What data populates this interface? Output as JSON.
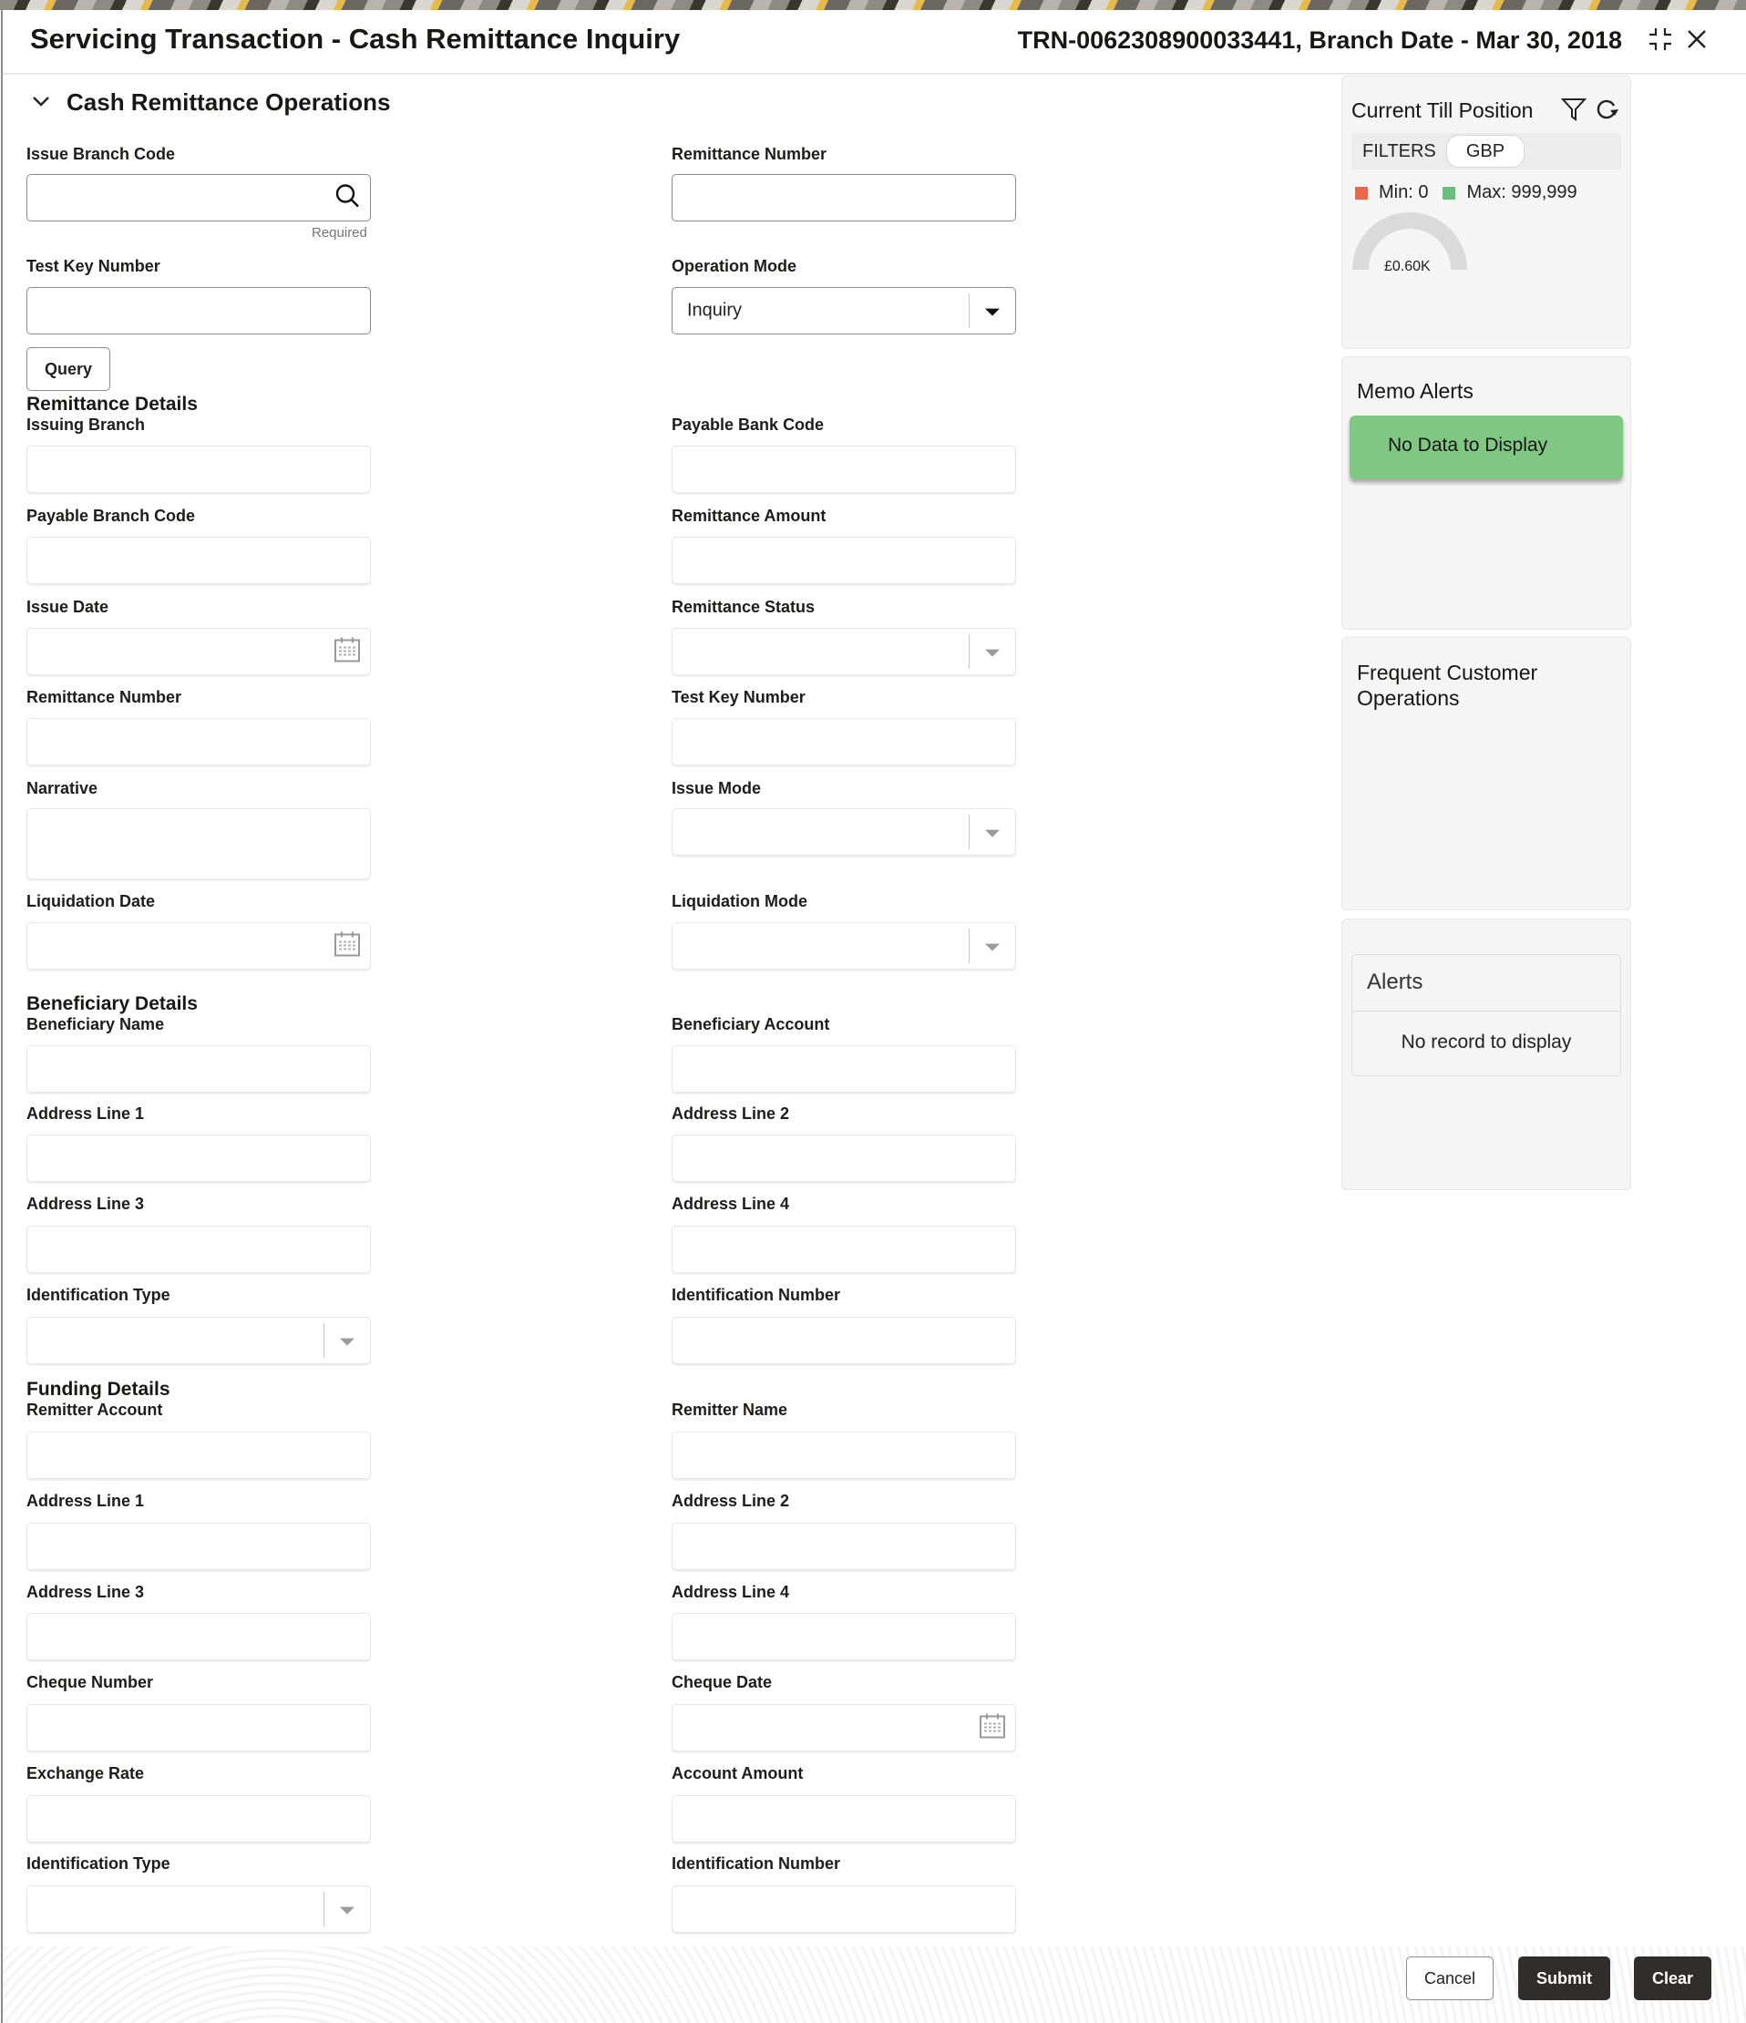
{
  "header": {
    "title": "Servicing Transaction - Cash Remittance Inquiry",
    "transaction_info": "TRN-0062308900033441, Branch Date - Mar 30, 2018",
    "minimize_icon": "minimize-icon",
    "close_icon": "close-icon"
  },
  "section": {
    "title": "Cash Remittance Operations",
    "toggle_icon": "chevron-down-icon"
  },
  "query": {
    "issue_branch_code": {
      "label": "Issue Branch Code",
      "value": "",
      "hint": "Required",
      "icon": "search-icon"
    },
    "remittance_number": {
      "label": "Remittance Number",
      "value": ""
    },
    "test_key_number": {
      "label": "Test Key Number",
      "value": ""
    },
    "operation_mode": {
      "label": "Operation Mode",
      "value": "Inquiry"
    },
    "query_button": "Query"
  },
  "remittance_details": {
    "title": "Remittance Details",
    "issuing_branch": {
      "label": "Issuing Branch",
      "value": ""
    },
    "payable_bank_code": {
      "label": "Payable Bank Code",
      "value": ""
    },
    "payable_branch_code": {
      "label": "Payable Branch Code",
      "value": ""
    },
    "remittance_amount": {
      "label": "Remittance Amount",
      "value": ""
    },
    "issue_date": {
      "label": "Issue Date",
      "value": ""
    },
    "remittance_status": {
      "label": "Remittance Status",
      "value": ""
    },
    "remittance_number": {
      "label": "Remittance Number",
      "value": ""
    },
    "test_key_number": {
      "label": "Test Key Number",
      "value": ""
    },
    "narrative": {
      "label": "Narrative",
      "value": ""
    },
    "issue_mode": {
      "label": "Issue Mode",
      "value": ""
    },
    "liquidation_date": {
      "label": "Liquidation Date",
      "value": ""
    },
    "liquidation_mode": {
      "label": "Liquidation Mode",
      "value": ""
    }
  },
  "beneficiary_details": {
    "title": "Beneficiary Details",
    "beneficiary_name": {
      "label": "Beneficiary Name",
      "value": ""
    },
    "beneficiary_account": {
      "label": "Beneficiary Account",
      "value": ""
    },
    "address_line_1": {
      "label": "Address Line 1",
      "value": ""
    },
    "address_line_2": {
      "label": "Address Line 2",
      "value": ""
    },
    "address_line_3": {
      "label": "Address Line 3",
      "value": ""
    },
    "address_line_4": {
      "label": "Address Line 4",
      "value": ""
    },
    "identification_type": {
      "label": "Identification Type",
      "value": ""
    },
    "identification_number": {
      "label": "Identification Number",
      "value": ""
    }
  },
  "funding_details": {
    "title": "Funding Details",
    "remitter_account": {
      "label": "Remitter Account",
      "value": ""
    },
    "remitter_name": {
      "label": "Remitter Name",
      "value": ""
    },
    "address_line_1": {
      "label": "Address Line 1",
      "value": ""
    },
    "address_line_2": {
      "label": "Address Line 2",
      "value": ""
    },
    "address_line_3": {
      "label": "Address Line 3",
      "value": ""
    },
    "address_line_4": {
      "label": "Address Line 4",
      "value": ""
    },
    "cheque_number": {
      "label": "Cheque Number",
      "value": ""
    },
    "cheque_date": {
      "label": "Cheque Date",
      "value": ""
    },
    "exchange_rate": {
      "label": "Exchange Rate",
      "value": ""
    },
    "account_amount": {
      "label": "Account Amount",
      "value": ""
    },
    "identification_type": {
      "label": "Identification Type",
      "value": ""
    },
    "identification_number": {
      "label": "Identification Number",
      "value": ""
    }
  },
  "sidebar": {
    "till": {
      "title": "Current Till Position",
      "filters_label": "FILTERS",
      "currency": "GBP",
      "min_label": "Min: 0",
      "max_label": "Max: 999,999",
      "min_color": "#e9674a",
      "max_color": "#68bf7e",
      "gauge_value": "£0.60K",
      "gauge_fraction": 0.0006
    },
    "memo_alerts": {
      "title": "Memo Alerts",
      "empty_text": "No Data to Display",
      "color": "#81c784"
    },
    "frequent_ops": {
      "title": "Frequent Customer Operations"
    },
    "alerts": {
      "title": "Alerts",
      "empty_text": "No record to display"
    }
  },
  "footer": {
    "cancel": "Cancel",
    "submit": "Submit",
    "clear": "Clear"
  }
}
